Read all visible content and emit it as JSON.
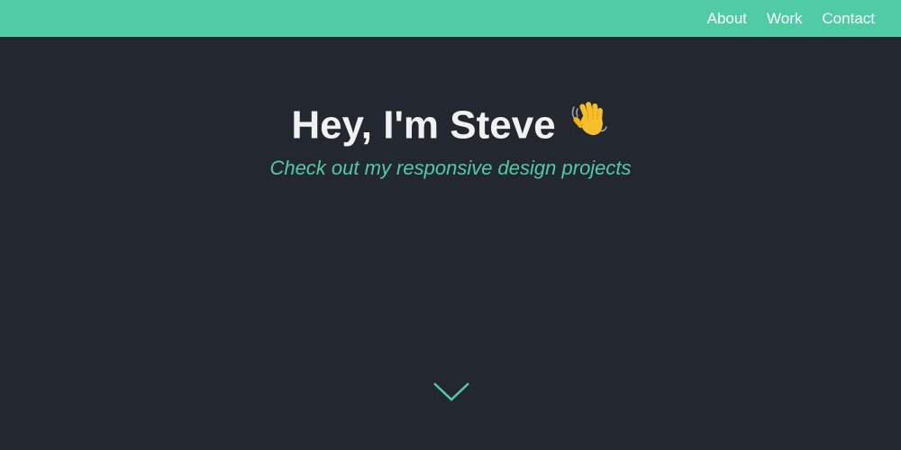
{
  "nav": {
    "links": [
      {
        "label": "About"
      },
      {
        "label": "Work"
      },
      {
        "label": "Contact"
      }
    ]
  },
  "hero": {
    "title": "Hey, I'm Steve",
    "emoji_icon": "waving-hand-icon",
    "subtitle": "Check out my responsive design projects",
    "scroll_icon": "chevron-down-icon"
  },
  "colors": {
    "accent": "#4fcca3",
    "background": "#23272f",
    "title_text": "#f1f1f1",
    "nav_text": "#ffffff"
  }
}
